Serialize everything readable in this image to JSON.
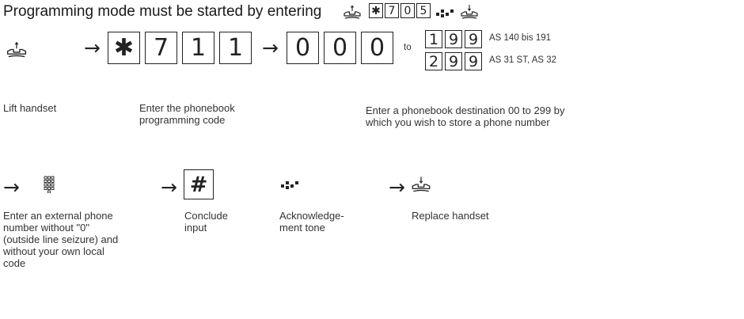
{
  "header": {
    "title": "Programming mode must be started by entering",
    "start_keys": [
      "✱",
      "7",
      "0",
      "5"
    ]
  },
  "row1": {
    "code_keys": [
      "✱",
      "7",
      "1",
      "1"
    ],
    "dest_keys": [
      "0",
      "0",
      "0"
    ],
    "to_text": "to",
    "range_a_keys": [
      "1",
      "9",
      "9"
    ],
    "range_a_label": "AS 140 bis 191",
    "range_b_keys": [
      "2",
      "9",
      "9"
    ],
    "range_b_label": "AS 31 ST, AS 32"
  },
  "labels1": {
    "lift": "Lift handset",
    "code_line1": "Enter the phonebook",
    "code_line2": "programming code",
    "dest_line1": "Enter a phonebook destination 00  to 299 by",
    "dest_line2": "which you wish to store a phone number"
  },
  "row2": {
    "hash_key": "#"
  },
  "labels2": {
    "ext_line1": "Enter an external phone",
    "ext_line2": "number without \"0\"",
    "ext_line3": "(outside line seizure) and",
    "ext_line4": "without your own local",
    "ext_line5": "code",
    "conclude_line1": "Conclude",
    "conclude_line2": "input",
    "ack_line1": "Acknowledge-",
    "ack_line2": "ment tone",
    "replace": "Replace handset"
  },
  "icons": {
    "lift": "handset-lift-icon",
    "replace": "handset-replace-icon",
    "keypad": "keypad-icon",
    "tone": "acknowledge-tone-icon",
    "arrow": "arrow-right-icon"
  }
}
